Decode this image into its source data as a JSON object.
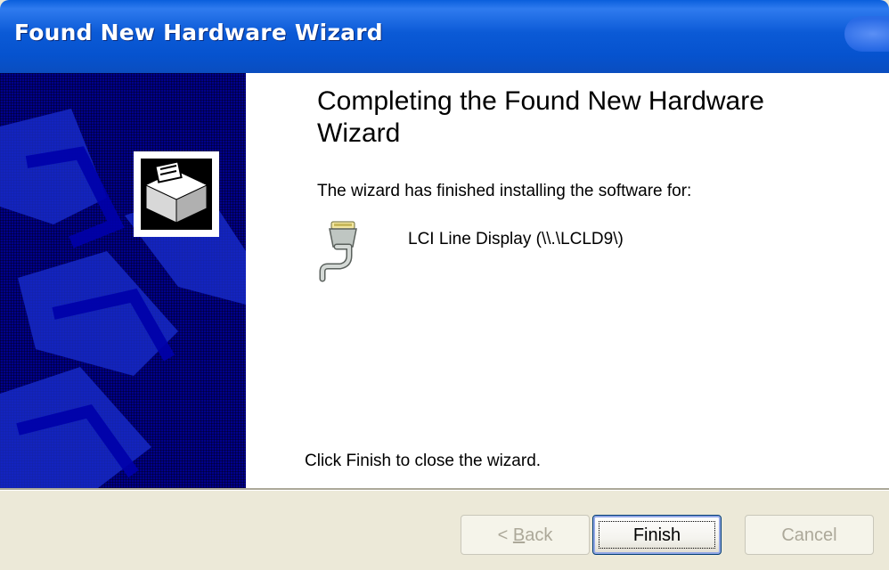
{
  "window": {
    "title": "Found New Hardware Wizard"
  },
  "content": {
    "heading": "Completing the Found New Hardware Wizard",
    "intro": "The wizard has finished installing the software for:",
    "device_name": "LCI Line Display (\\\\.\\LCLD9\\)",
    "finish_hint": "Click Finish to close the wizard."
  },
  "icons": {
    "banner": "hardware-wizard-icon",
    "device": "serial-port-connector-icon"
  },
  "buttons": {
    "back": {
      "prefix": "< ",
      "accel": "B",
      "rest": "ack",
      "enabled": false
    },
    "finish": {
      "label": "Finish",
      "enabled": true,
      "default": true
    },
    "cancel": {
      "label": "Cancel",
      "enabled": false
    }
  },
  "colors": {
    "titlebar": "#0a5fdc",
    "banner": "#00008b",
    "dialog_bg": "#ece9d8"
  }
}
